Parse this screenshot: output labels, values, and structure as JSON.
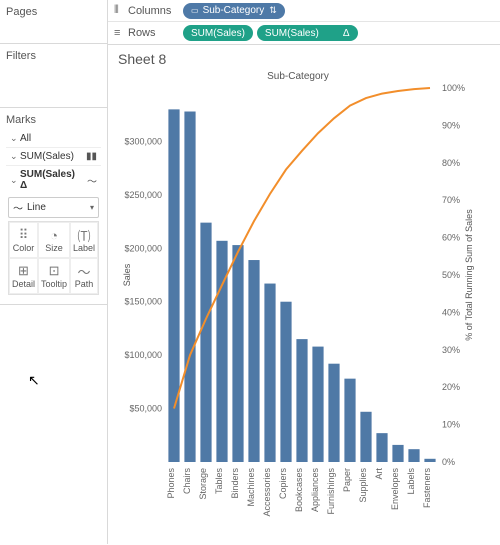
{
  "panels": {
    "pages": "Pages",
    "filters": "Filters",
    "marks": "Marks"
  },
  "marks": {
    "rows": [
      {
        "label": "All",
        "icon": ""
      },
      {
        "label": "SUM(Sales)",
        "icon": "bar"
      },
      {
        "label": "SUM(Sales)",
        "icon": "line",
        "delta": "Δ",
        "bold": true
      }
    ],
    "dropdown": {
      "value": "Line"
    },
    "buttons": [
      "Color",
      "Size",
      "Label",
      "Detail",
      "Tooltip",
      "Path"
    ]
  },
  "shelves": {
    "columns": {
      "label": "Columns",
      "pill": "Sub-Category",
      "sort": true
    },
    "rows": {
      "label": "Rows",
      "pills": [
        "SUM(Sales)",
        "SUM(Sales)"
      ],
      "delta_on_second": "Δ"
    }
  },
  "sheet": {
    "title": "Sheet 8"
  },
  "chart_data": {
    "type": "bar",
    "title": "Sub-Category",
    "ylabel": "Sales",
    "y2label": "% of Total Running Sum of Sales",
    "ylim": [
      0,
      350000
    ],
    "y_ticks": [
      "$50,000",
      "$100,000",
      "$150,000",
      "$200,000",
      "$250,000",
      "$300,000"
    ],
    "y2lim": [
      0,
      100
    ],
    "y2_ticks": [
      "0%",
      "10%",
      "20%",
      "30%",
      "40%",
      "50%",
      "60%",
      "70%",
      "80%",
      "90%",
      "100%"
    ],
    "categories": [
      "Phones",
      "Chairs",
      "Storage",
      "Tables",
      "Binders",
      "Machines",
      "Accessories",
      "Copiers",
      "Bookcases",
      "Appliances",
      "Furnishings",
      "Paper",
      "Supplies",
      "Art",
      "Envelopes",
      "Labels",
      "Fasteners"
    ],
    "series": [
      {
        "name": "Sales",
        "type": "bar",
        "values": [
          330000,
          328000,
          224000,
          207000,
          203000,
          189000,
          167000,
          150000,
          115000,
          108000,
          92000,
          78000,
          47000,
          27000,
          16000,
          12000,
          3000
        ]
      },
      {
        "name": "Running %",
        "type": "line",
        "values": [
          14.3,
          28.6,
          38.3,
          47.3,
          56.2,
          64.4,
          71.7,
          78.2,
          83.2,
          87.9,
          91.9,
          95.3,
          97.3,
          98.5,
          99.2,
          99.7,
          100.0
        ]
      }
    ]
  }
}
